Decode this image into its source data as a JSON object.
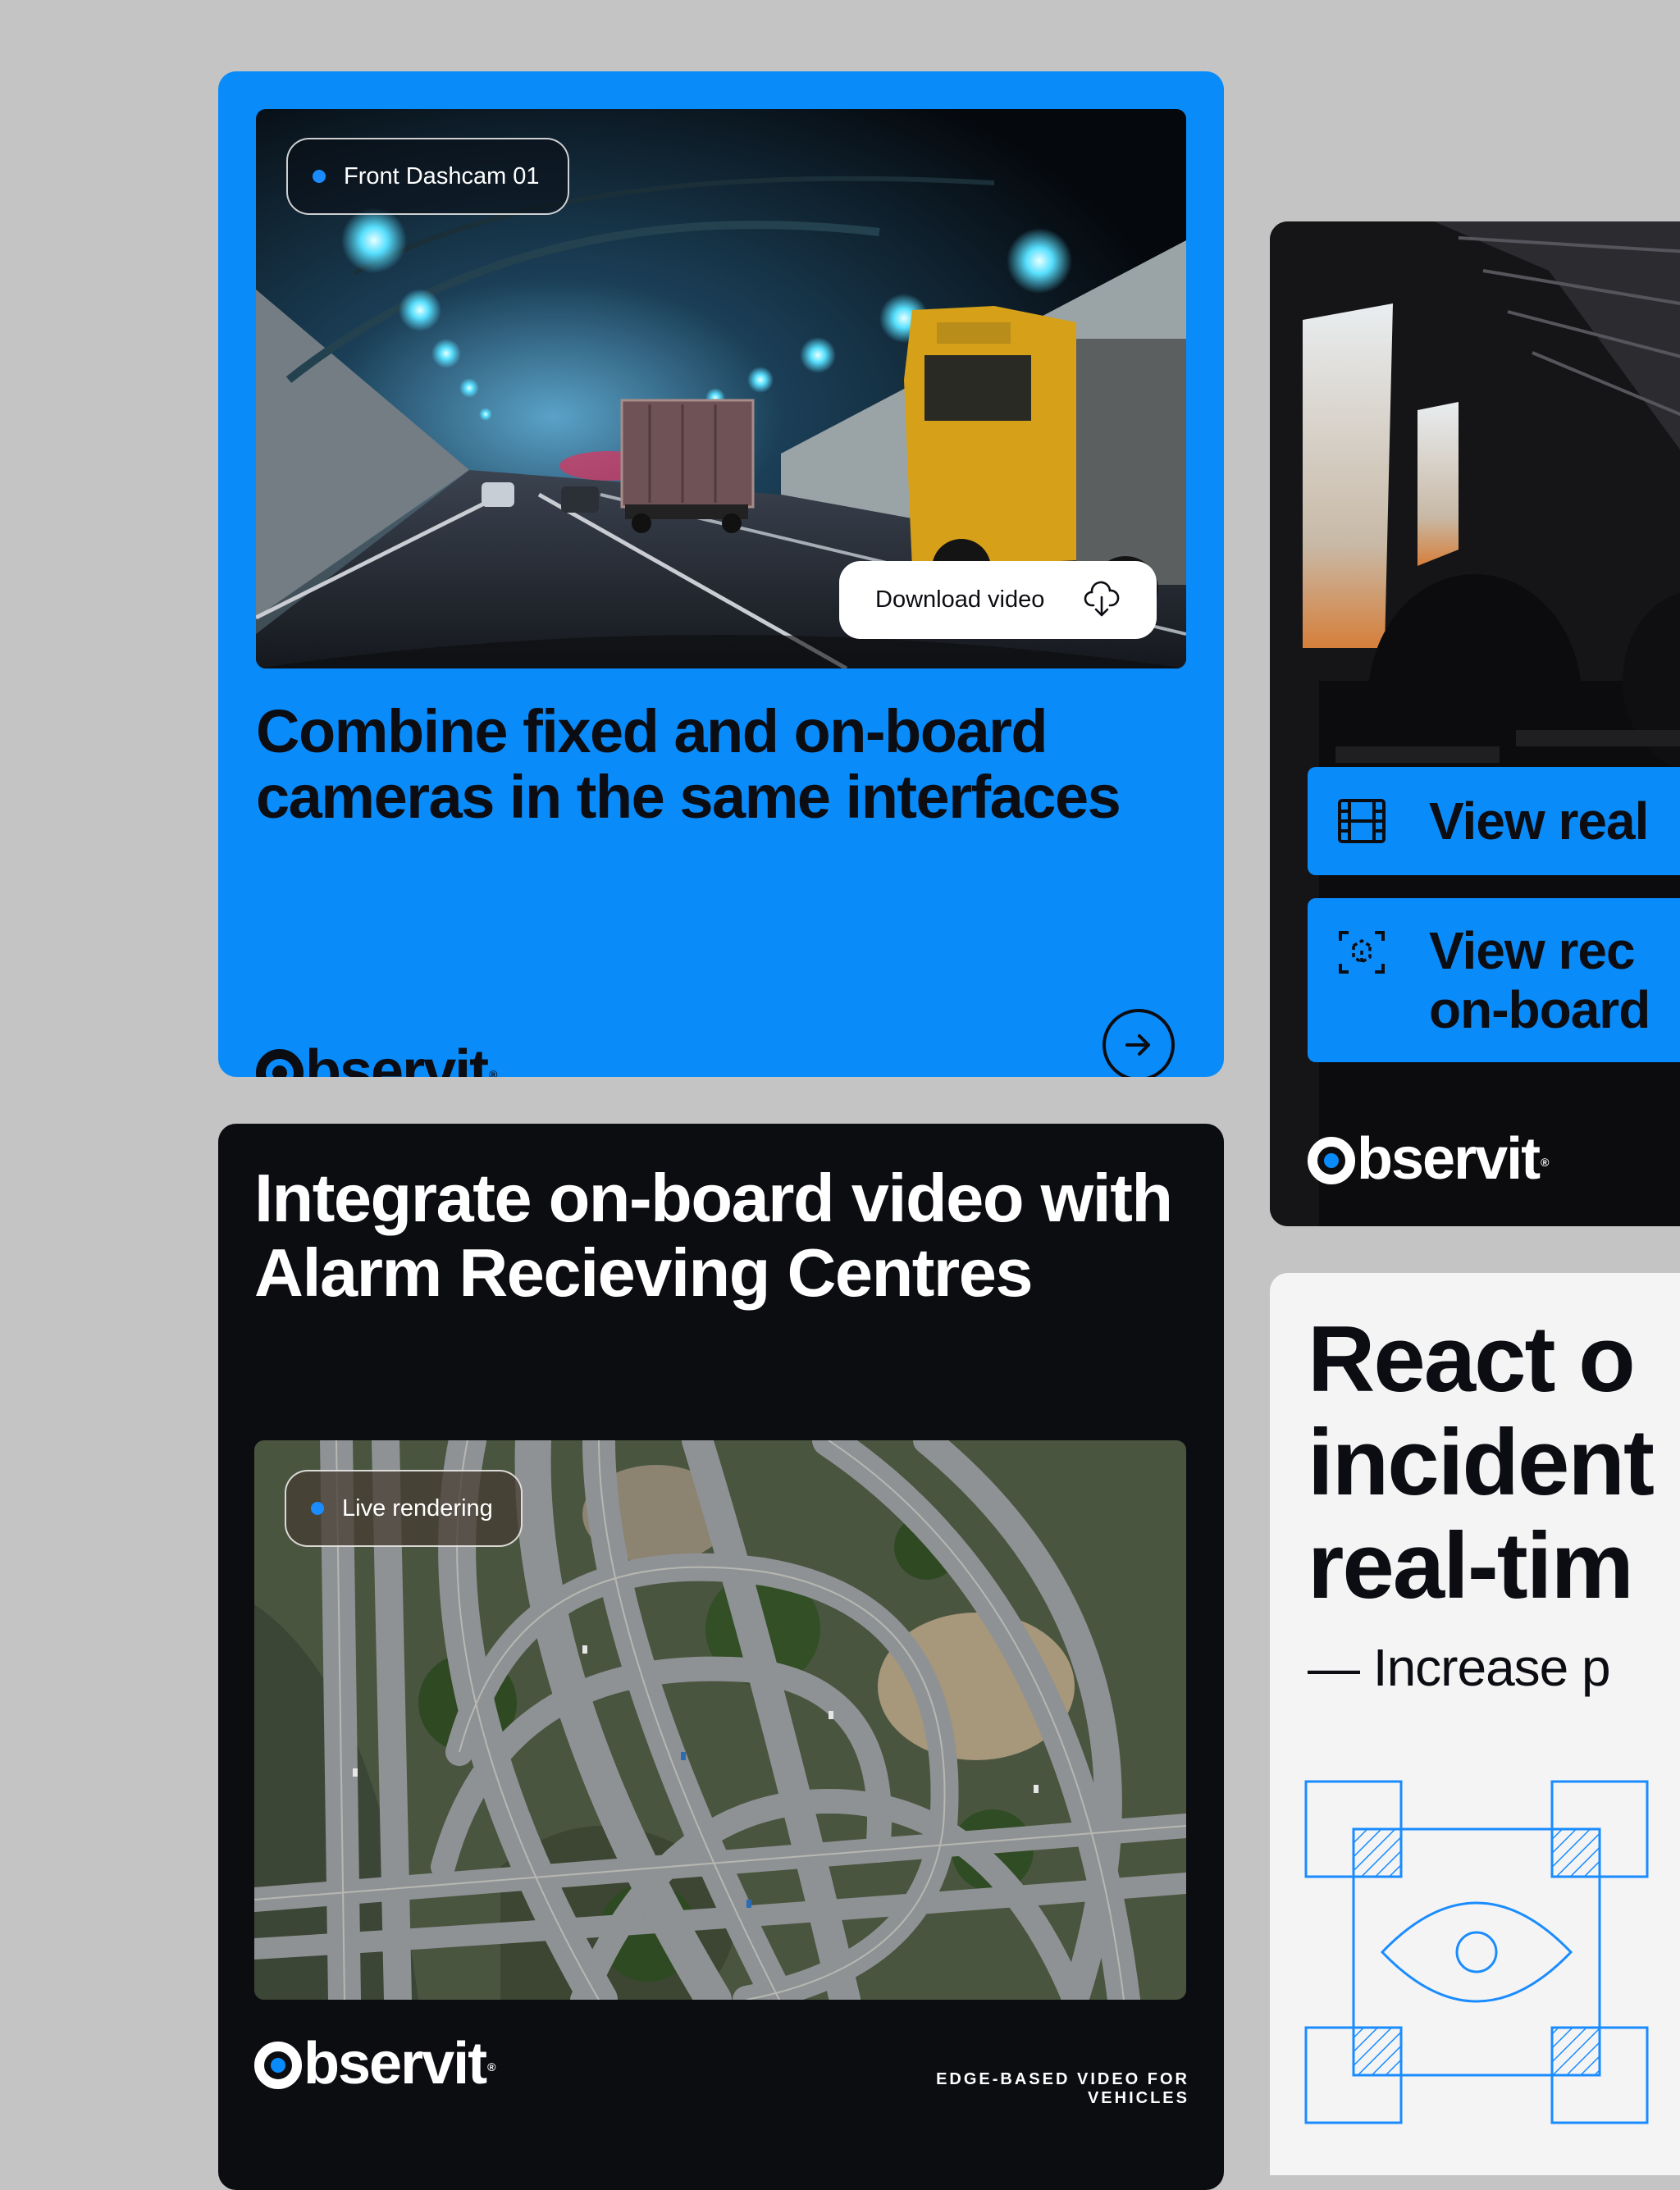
{
  "brand": {
    "name": "Observit",
    "name_rest": "bservit",
    "registered": "®",
    "accent_color": "#0a8bfa",
    "dark_color": "#0c0d11",
    "light_color": "#f4f4f4"
  },
  "card_fixed_onboard": {
    "camera_label": "Front Dashcam 01",
    "download_label": "Download video",
    "headline": "Combine fixed and on-board cameras in the same interfaces",
    "arrow_icon": "arrow-right-icon"
  },
  "card_alarm": {
    "headline": "Integrate on-board video with Alarm Recieving Centres",
    "status_label": "Live rendering",
    "tagline": "EDGE-BASED VIDEO FOR VEHICLES"
  },
  "card_bus": {
    "buttons": [
      {
        "label": "View real",
        "icon": "film-icon"
      },
      {
        "label_line1": "View rec",
        "label_line2": "on-board",
        "icon": "focus-icon"
      }
    ]
  },
  "card_react": {
    "headline": "React o\nincident\nreal-tim",
    "subtext": "— Increase p"
  }
}
